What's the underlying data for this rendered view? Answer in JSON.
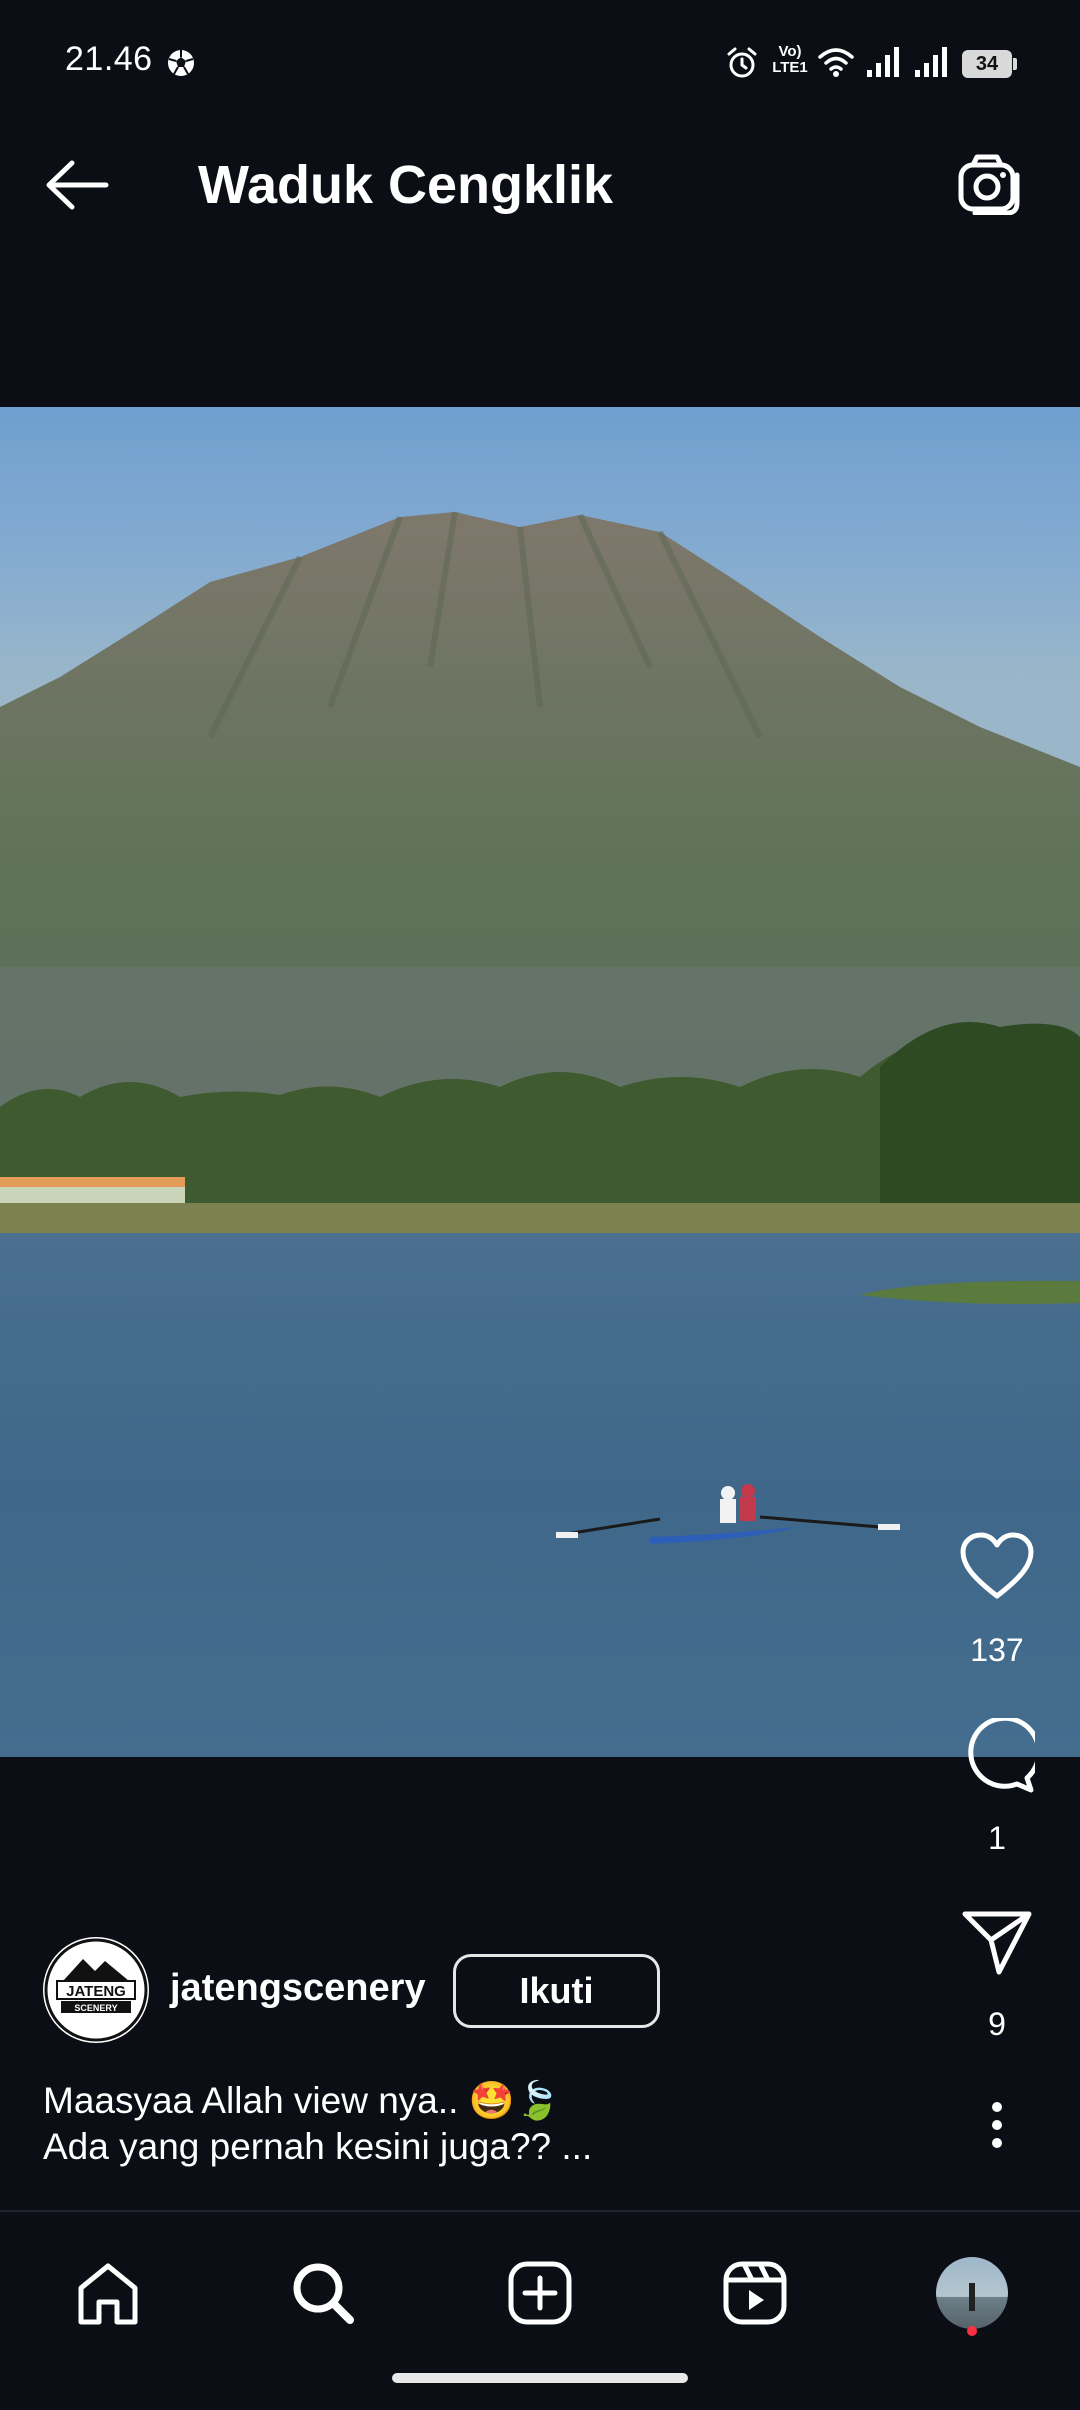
{
  "status_bar": {
    "time": "21.46",
    "battery": "34",
    "icons": [
      "soccer-ball-icon",
      "alarm-icon",
      "volte-icon",
      "wifi-icon",
      "signal-icon",
      "signal-icon",
      "battery-icon"
    ],
    "volte_label": "Vo)",
    "lte_label": "LTE1"
  },
  "header": {
    "title": "Waduk Cengklik",
    "back_icon": "arrow-left-icon",
    "camera_icon": "camera-icon"
  },
  "post": {
    "author": "jatengscenery",
    "author_logo_text": "JATENG",
    "author_logo_subtext": "SCENERY",
    "follow_label": "Ikuti",
    "caption_line1": "Maasyaa Allah view nya.. 🤩🍃",
    "caption_line2": "Ada yang pernah kesini juga?? ...",
    "likes": "137",
    "comments": "1",
    "shares": "9"
  },
  "bottom_nav": {
    "items": [
      "home-icon",
      "search-icon",
      "create-icon",
      "reels-icon",
      "profile-avatar"
    ]
  },
  "colors": {
    "background": "#0b0e14",
    "text": "#ffffff",
    "notification_dot": "#ff3040"
  }
}
